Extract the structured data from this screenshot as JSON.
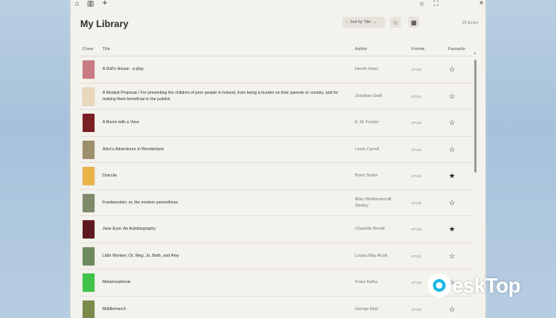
{
  "app": {
    "page_title": "My Library",
    "sort_label": "Sort by Title",
    "book_count": "20 books"
  },
  "table": {
    "headers": {
      "cover": "Cover",
      "title": "Title",
      "author": "Author",
      "format": "Format",
      "favourite": "Favourite"
    },
    "rows": [
      {
        "title": "A Doll's House : a play",
        "author": "Henrik Ibsen",
        "format": "EPUB",
        "favourite": false,
        "cover_color": "#c97b84"
      },
      {
        "title": "A Modest Proposal / For preventing the children of poor people in Ireland, from being a burden on their parents or country, and for making them beneficial to the publick",
        "author": "Jonathan Swift",
        "format": "EPUB",
        "favourite": false,
        "cover_color": "#e8d7b9"
      },
      {
        "title": "A Room with a View",
        "author": "E. M. Forster",
        "format": "EPUB",
        "favourite": false,
        "cover_color": "#7a1f24"
      },
      {
        "title": "Alice's Adventures in Wonderland",
        "author": "Lewis Carroll",
        "format": "EPUB",
        "favourite": false,
        "cover_color": "#9d8f6c"
      },
      {
        "title": "Dracula",
        "author": "Bram Stoker",
        "format": "EPUB",
        "favourite": true,
        "cover_color": "#e8b347"
      },
      {
        "title": "Frankenstein; or, the modern prometheus",
        "author": "Mary Wollstonecraft Shelley",
        "format": "EPUB",
        "favourite": false,
        "cover_color": "#7e8a6a"
      },
      {
        "title": "Jane Eyre: An Autobiography",
        "author": "Charlotte Brontë",
        "format": "EPUB",
        "favourite": true,
        "cover_color": "#5e1a1e"
      },
      {
        "title": "Little Women; Or, Meg, Jo, Beth, and Amy",
        "author": "Louisa May Alcott",
        "format": "EPUB",
        "favourite": false,
        "cover_color": "#6e8a5e"
      },
      {
        "title": "Metamorphosis",
        "author": "Franz Kafka",
        "format": "EPUB",
        "favourite": false,
        "cover_color": "#3fc24a"
      },
      {
        "title": "Middlemarch",
        "author": "George Eliot",
        "format": "EPUB",
        "favourite": false,
        "cover_color": "#7a8a4a"
      }
    ]
  },
  "icons": {
    "star_empty": "☆",
    "star_filled": "★"
  },
  "watermark": {
    "text": "eskTop"
  }
}
